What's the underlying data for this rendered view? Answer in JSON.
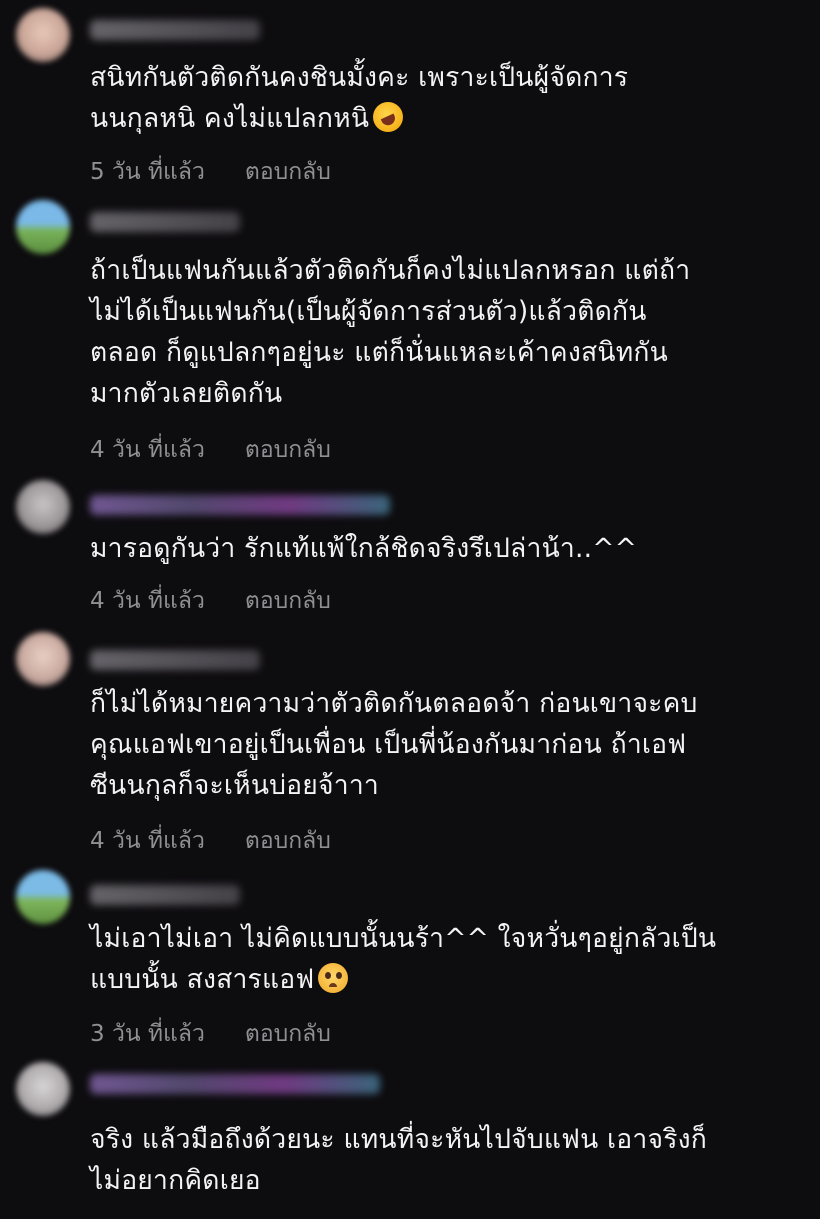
{
  "comments": [
    {
      "text": "สนิทกันตัวติดกันคงชินมั้งคะ เพราะเป็นผู้จัดการ\nนนกุลหนิ คงไม่แปลกหนิ",
      "emoji": "rolling-on-floor-laughing-emoji",
      "time": "5 วัน ที่แล้ว",
      "reply": "ตอบกลับ"
    },
    {
      "text": "ถ้าเป็นแฟนกันแล้วตัวติดกันก็คงไม่แปลกหรอก แต่ถ้า\nไม่ได้เป็นแฟนกัน(เป็นผู้จัดการส่วนตัว)แล้วติดกัน\nตลอด ก็ดูแปลกๆอยู่นะ แต่ก็นั่นแหละเค้าคงสนิทกัน\nมากตัวเลยติดกัน",
      "time": "4 วัน ที่แล้ว",
      "reply": "ตอบกลับ"
    },
    {
      "text": "มารอดูกันว่า รักแท้แพ้ใกล้ชิดจริงรึเปล่าน้า..^^",
      "time": "4 วัน ที่แล้ว",
      "reply": "ตอบกลับ"
    },
    {
      "text": "ก็ไม่ได้หมายความว่าตัวติดกันตลอดจ้า ก่อนเขาจะคบ\nคุณแอฟเขาอยู่เป็นเพื่อน เป็นพี่น้องกันมาก่อน ถ้าเอฟ\nซีนนกุลก็จะเห็นบ่อยจ้าาา",
      "time": "4 วัน ที่แล้ว",
      "reply": "ตอบกลับ"
    },
    {
      "text": "ไม่เอาไม่เอา ไม่คิดแบบนั้นนร้า^^ ใจหวั่นๆอยู่กลัวเป็น\nแบบนั้น สงสารแอฟ",
      "emoji": "pleading-face-emoji",
      "time": "3 วัน ที่แล้ว",
      "reply": "ตอบกลับ"
    },
    {
      "text": "จริง แล้วมือถึงด้วยนะ แทนที่จะหันไปจับแฟน เอาจริงก็\nไม่อยากคิดเยอ"
    }
  ]
}
